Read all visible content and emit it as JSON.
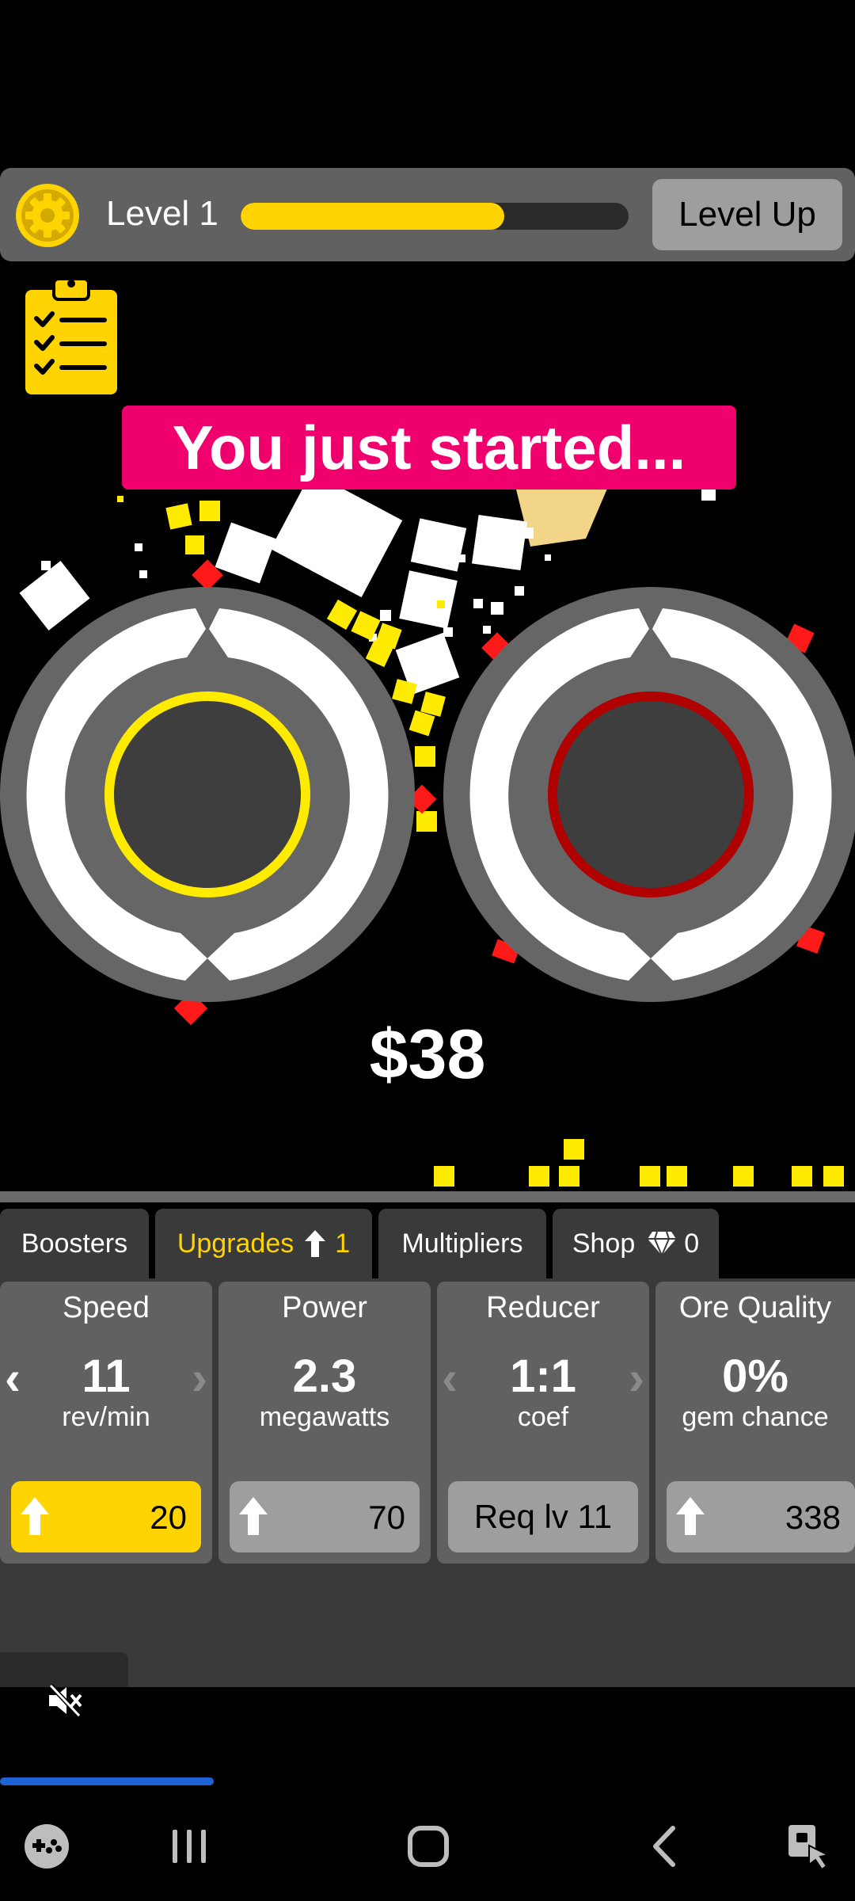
{
  "top_bar": {
    "level_label": "Level 1",
    "xp_progress": 0.68,
    "level_up_label": "Level Up"
  },
  "banner": {
    "text": "You just started..."
  },
  "money": {
    "text": "$38"
  },
  "tabs": [
    {
      "label": "Boosters",
      "active": false
    },
    {
      "label": "Upgrades",
      "badge": "1",
      "active": true
    },
    {
      "label": "Multipliers",
      "active": false
    },
    {
      "label": "Shop",
      "badge": "0",
      "active": false
    }
  ],
  "cards": [
    {
      "title": "Speed",
      "value": "11",
      "unit": "rev/min",
      "button": "20",
      "button_type": "upgrade-yellow"
    },
    {
      "title": "Power",
      "value": "2.3",
      "unit": "megawatts",
      "button": "70",
      "button_type": "upgrade-gray"
    },
    {
      "title": "Reducer",
      "value": "1:1",
      "unit": "coef",
      "button": "Req lv 11",
      "button_type": "locked"
    },
    {
      "title": "Ore Quality",
      "value": "0%",
      "unit": "gem chance",
      "button": "338",
      "button_type": "upgrade-gray"
    }
  ],
  "colors": {
    "accent_yellow": "#FFD400",
    "banner_pink": "#F0006C",
    "ring_red": "#B00000",
    "panel_gray": "#616161",
    "video_progress": "#1e63d6"
  },
  "video": {
    "progress": 0.25
  },
  "icons": [
    "gear-icon",
    "clipboard-checklist-icon",
    "mute-icon",
    "game-controller-icon",
    "recent-apps-icon",
    "home-icon",
    "back-icon",
    "touch-lock-icon",
    "diamond-icon",
    "arrow-up-icon"
  ]
}
